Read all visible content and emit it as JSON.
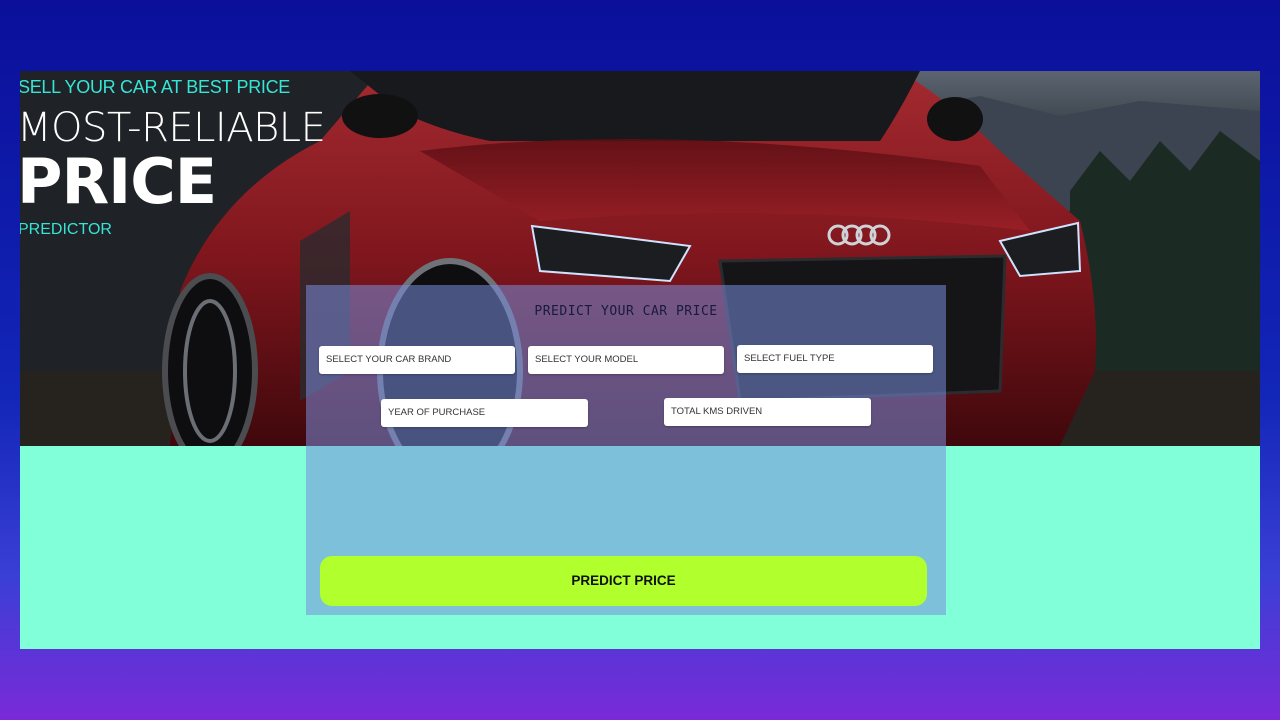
{
  "hero": {
    "tagline": "SELL YOUR CAR AT BEST PRICE",
    "headline_line1": "MOST-RELIABLE",
    "headline_line2": "PRICE",
    "headline_line3": "PREDICTOR"
  },
  "form": {
    "title": "PREDICT YOUR CAR PRICE",
    "fields": {
      "car_brand": "SELECT YOUR CAR BRAND",
      "model": "SELECT YOUR MODEL",
      "fuel_type": "SELECT FUEL TYPE",
      "year_of_purchase": "YEAR OF PURCHASE",
      "total_kms": "TOTAL KMS DRIVEN"
    },
    "submit_label": "PREDICT PRICE"
  },
  "colors": {
    "accent_cyan": "#35e6d7",
    "mint_background": "#80ffd8",
    "button_lime": "#b1ff2d",
    "car_red": "#8e1a22"
  }
}
